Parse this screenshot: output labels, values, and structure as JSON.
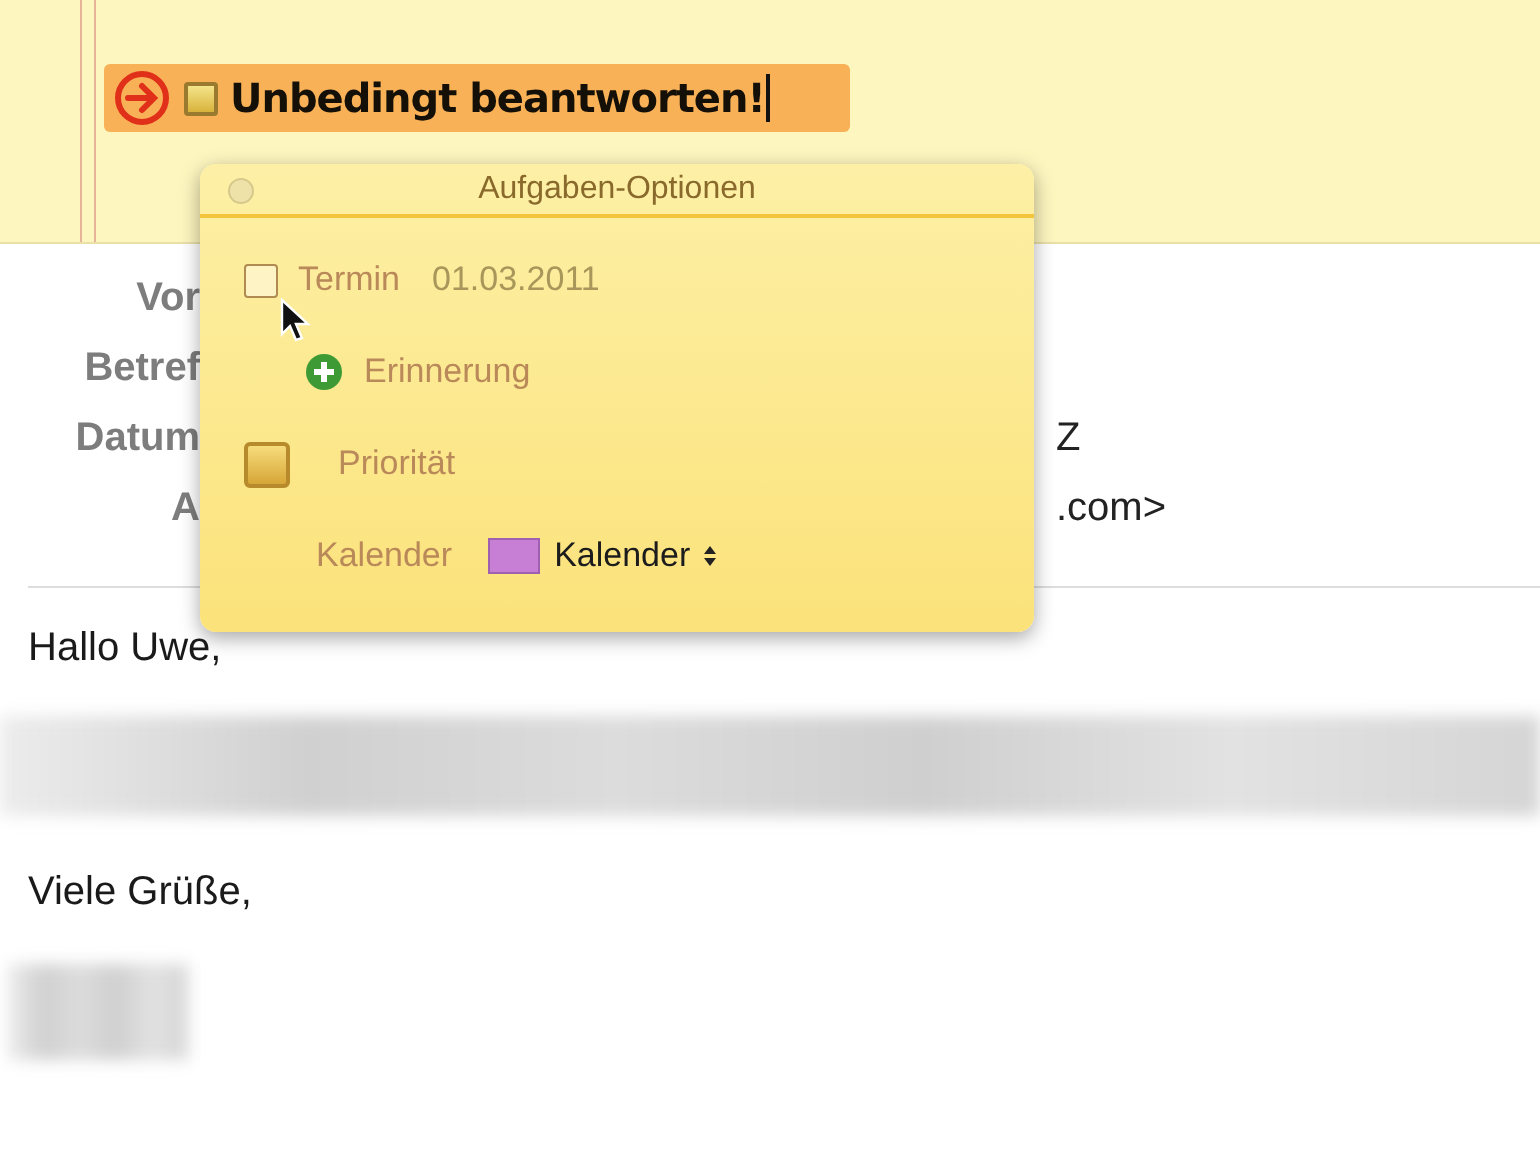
{
  "task": {
    "title": "Unbedingt beantworten!",
    "checked": false
  },
  "popup": {
    "title": "Aufgaben-Optionen",
    "rows": [
      {
        "kind": "date",
        "label": "Termin",
        "value": "01.03.2011",
        "checked": false
      },
      {
        "kind": "add",
        "label": "Erinnerung"
      },
      {
        "kind": "priority",
        "label": "Priorität"
      },
      {
        "kind": "calendar",
        "label": "Kalender",
        "value": "Kalender",
        "color": "#c77fd6"
      }
    ]
  },
  "header": [
    {
      "label": "Vor"
    },
    {
      "label": "Betref"
    },
    {
      "label": "Datum",
      "value": "Z"
    },
    {
      "label": "A",
      "value": ".com>"
    }
  ],
  "body": [
    {
      "kind": "text",
      "text": "Hallo Uwe,"
    },
    {
      "kind": "blur"
    },
    {
      "kind": "text",
      "text": "Viele Grüße,"
    },
    {
      "kind": "blur-short"
    }
  ]
}
